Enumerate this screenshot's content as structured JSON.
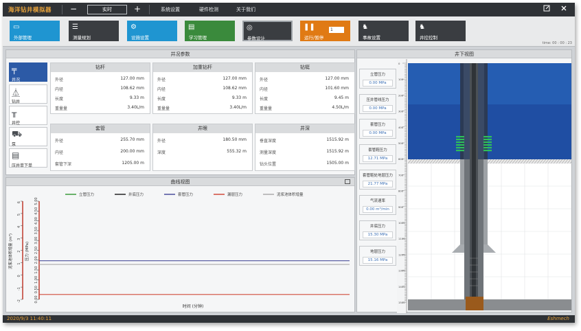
{
  "app": {
    "title": "海洋钻井模拟器"
  },
  "titlebar": {
    "speed_label": "实时",
    "menu": [
      "系统设置",
      "硬件检测",
      "关于我们"
    ],
    "minus": "−",
    "plus": "+",
    "restore_icon": "restore-icon",
    "close_icon": "close-icon"
  },
  "toolbar": {
    "buttons": [
      {
        "label": "外部管理",
        "icon": "window-icon",
        "color": "#1f95d1"
      },
      {
        "label": "测量规划",
        "icon": "sliders-icon",
        "color": "#3a3d41"
      },
      {
        "label": "设施设置",
        "icon": "gear-icon",
        "color": "#1f95d1"
      },
      {
        "label": "学习管理",
        "icon": "book-icon",
        "color": "#3a8a3c"
      },
      {
        "label": "参数设计",
        "icon": "eye-icon",
        "color": "#3a3d41"
      },
      {
        "label": "运行/暂停",
        "icon": "pause-icon",
        "color": "#e07a14"
      },
      {
        "label": "事故设置",
        "icon": "operator-icon",
        "color": "#3a3d41"
      },
      {
        "label": "井控控制",
        "icon": "operator-icon",
        "color": "#3a3d41"
      }
    ],
    "run_value": "1",
    "time_readout": "time: 00 : 00 : 23"
  },
  "params": {
    "title": "井况参数",
    "tabs": [
      {
        "label": "井况",
        "icon": "well-icon"
      },
      {
        "label": "钻井",
        "icon": "rig-icon"
      },
      {
        "label": "井控",
        "icon": "wellhead-icon"
      },
      {
        "label": "泵",
        "icon": "pump-icon"
      },
      {
        "label": "压井单下单",
        "icon": "document-icon"
      }
    ],
    "cards": [
      {
        "title": "钻杆",
        "rows": [
          [
            "外径",
            "127.00 mm"
          ],
          [
            "内径",
            "108.62 mm"
          ],
          [
            "长度",
            "9.33 m"
          ],
          [
            "重量量",
            "3.40L/m"
          ]
        ]
      },
      {
        "title": "加重钻杆",
        "rows": [
          [
            "外径",
            "127.00 mm"
          ],
          [
            "内径",
            "108.62 mm"
          ],
          [
            "长度",
            "9.33 m"
          ],
          [
            "重量量",
            "3.40L/m"
          ]
        ]
      },
      {
        "title": "钻铤",
        "rows": [
          [
            "外径",
            "127.00 mm"
          ],
          [
            "内径",
            "101.60 mm"
          ],
          [
            "长度",
            "9.45 m"
          ],
          [
            "重量量",
            "4.50L/m"
          ]
        ]
      },
      {
        "title": "套管",
        "rows": [
          [
            "外径",
            "255.70 mm"
          ],
          [
            "内径",
            "200.00 mm"
          ],
          [
            "套管下深",
            "1205.00 m"
          ]
        ]
      },
      {
        "title": "井眼",
        "rows": [
          [
            "外径",
            "180.50 mm"
          ],
          [
            "深度",
            "555.32 m"
          ]
        ]
      },
      {
        "title": "井深",
        "rows": [
          [
            "垂直深度",
            "1515.92 m"
          ],
          [
            "测量深度",
            "1515.92 m"
          ],
          [
            "钻头位置",
            "1505.00 m"
          ]
        ]
      }
    ]
  },
  "curves": {
    "title": "曲线视图",
    "expand_icon": "expand-icon",
    "xlabel": "时间 (分钟)",
    "left_axis_label": "泥浆池体积增量 (m³)",
    "right_axis_label": "压力 (MPa)"
  },
  "chart_data": {
    "type": "line",
    "legend": [
      {
        "name": "立管压力",
        "color": "#3a9a3a"
      },
      {
        "name": "井底压力",
        "color": "#222222"
      },
      {
        "name": "套管压力",
        "color": "#4a4f9a"
      },
      {
        "name": "漏层压力",
        "color": "#d04a3a"
      },
      {
        "name": "泥浆池体积增量",
        "color": "#aaaaaa"
      }
    ],
    "left_ticks": [
      "6",
      "5",
      "4",
      "3",
      "2",
      "1",
      "0",
      "-1",
      "-2"
    ],
    "right_ticks": [
      "5.00",
      "4.50",
      "4.00",
      "3.50",
      "3.00",
      "2.50",
      "2.00",
      "1.50",
      "1.00",
      "0.50",
      "0.00"
    ],
    "ylim_left": [
      -2,
      6
    ],
    "ylim_right": [
      0,
      5
    ],
    "series": [
      {
        "name": "套管压力",
        "axis": "left",
        "value": 1.15
      },
      {
        "name": "泥浆池体积增量",
        "axis": "left",
        "value": 0.85
      },
      {
        "name": "漏层压力",
        "axis": "left",
        "value": -1.6
      }
    ]
  },
  "wellbore": {
    "title": "井下视图",
    "gauges": [
      {
        "label": "立管压力",
        "value": "0.00 MPa"
      },
      {
        "label": "压井管线压力",
        "value": "0.00 MPa"
      },
      {
        "label": "套管压力",
        "value": "0.00 MPa"
      },
      {
        "label": "套管鞋压力",
        "value": "12.71 MPa"
      },
      {
        "label": "套管鞋处地层压力",
        "value": "21.77 MPa"
      },
      {
        "label": "气流速率",
        "value": "0.00 m³/min"
      },
      {
        "label": "井底压力",
        "value": "15.30 MPa"
      },
      {
        "label": "地层压力",
        "value": "15.16 MPa"
      }
    ],
    "depth_ticks": [
      "0",
      "100",
      "200",
      "300",
      "400",
      "500",
      "600",
      "700",
      "800",
      "900",
      "1000",
      "1100",
      "1200",
      "1300",
      "1400",
      "1500"
    ]
  },
  "status": {
    "time": "2020/9/3 11:40:11",
    "brand": "Eshmech"
  }
}
